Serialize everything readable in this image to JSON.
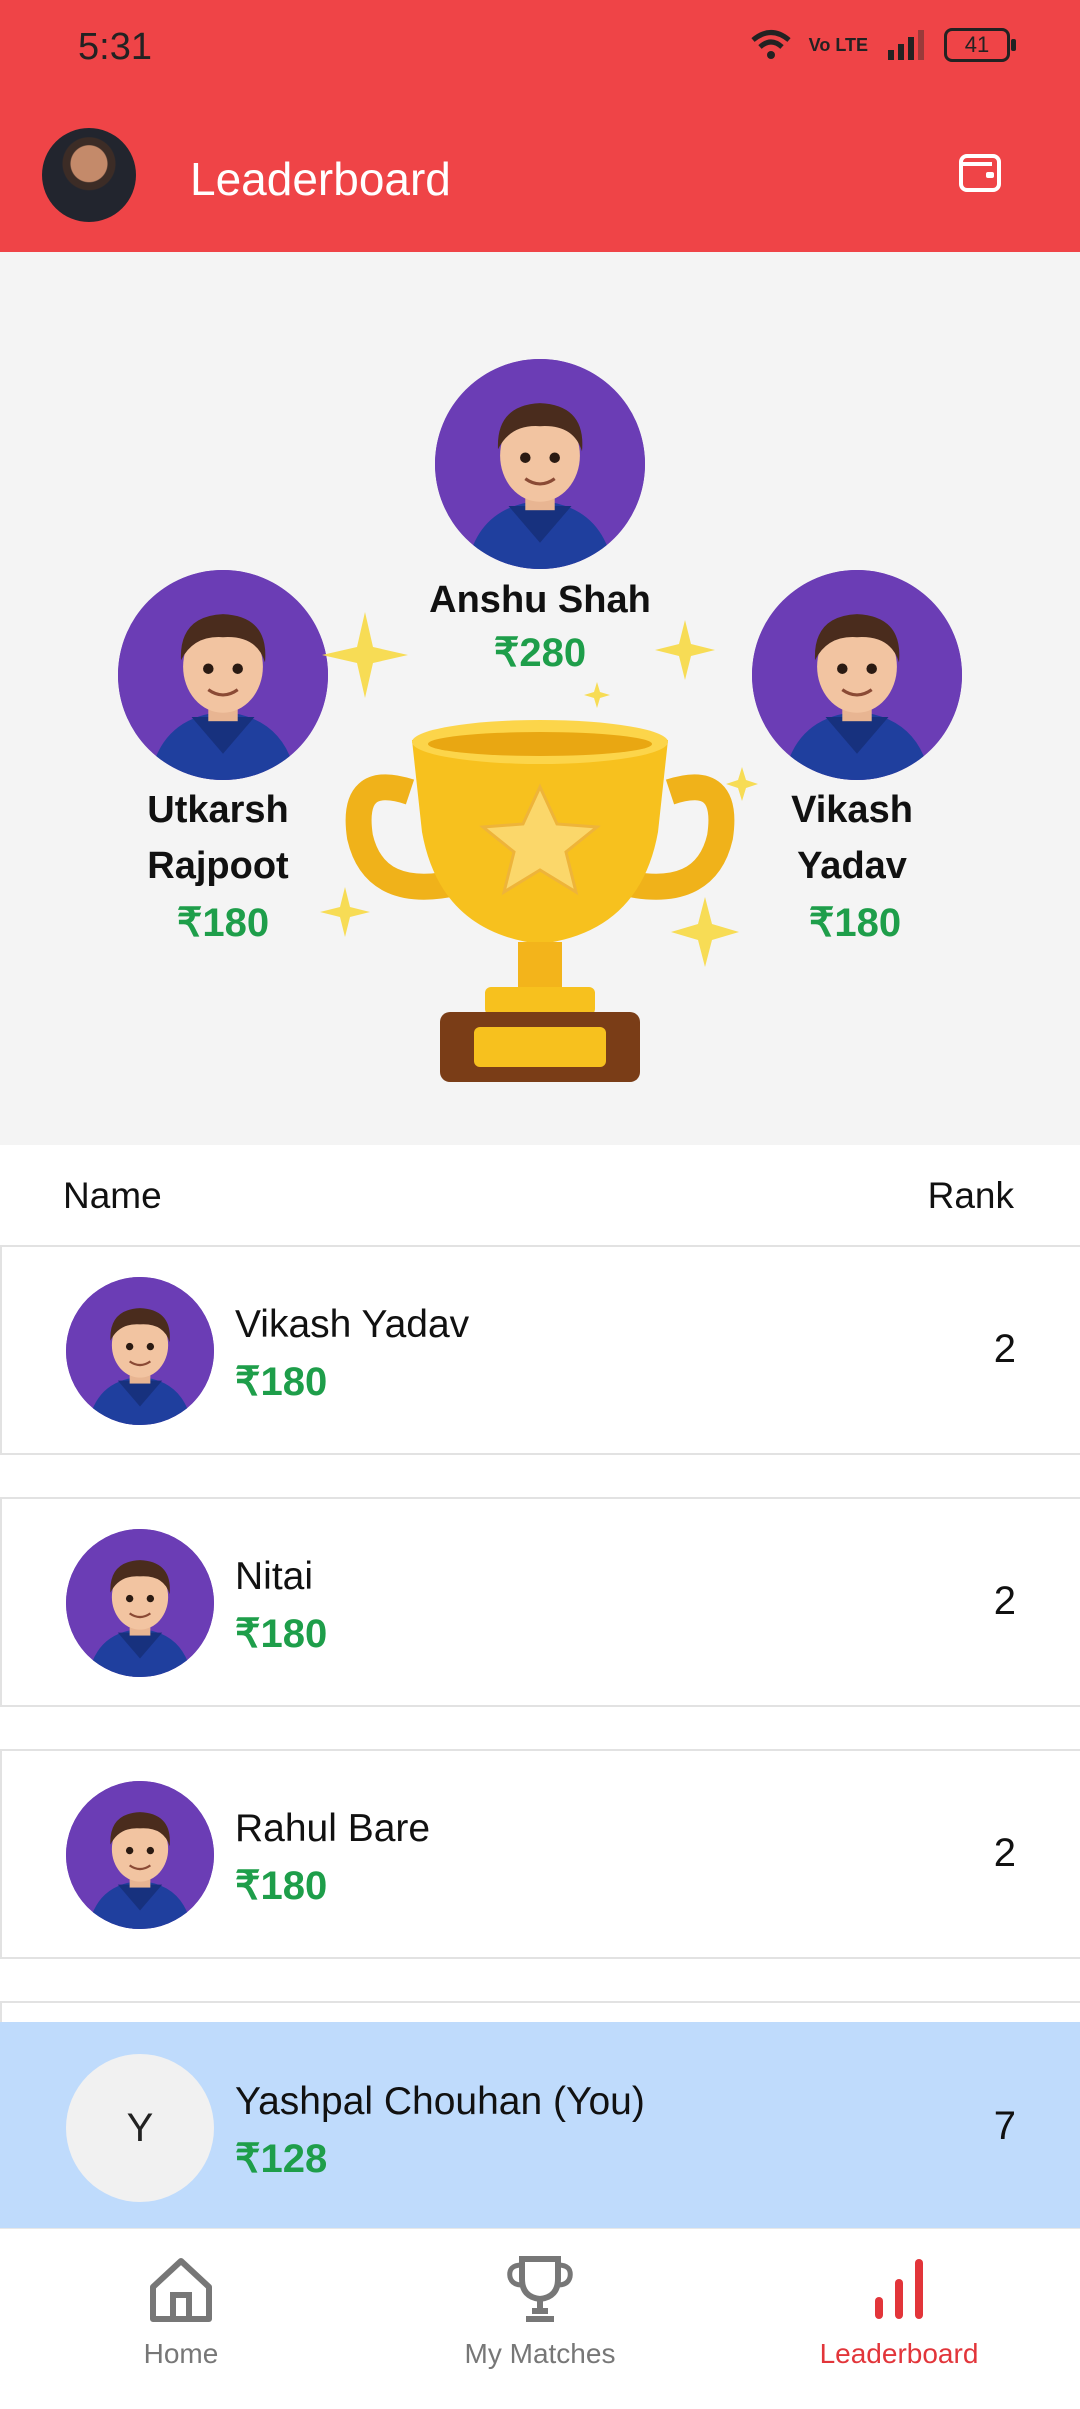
{
  "status_bar": {
    "time": "5:31",
    "network": "Vo LTE",
    "battery": "41"
  },
  "header": {
    "title": "Leaderboard"
  },
  "podium": {
    "first": {
      "name": "Anshu Shah",
      "amount": "₹280"
    },
    "second": {
      "name_line1": "Utkarsh",
      "name_line2": "Rajpoot",
      "amount": "₹180"
    },
    "third": {
      "name_line1": "Vikash",
      "name_line2": "Yadav",
      "amount": "₹180"
    }
  },
  "list": {
    "header_name": "Name",
    "header_rank": "Rank",
    "rows": [
      {
        "name": "Vikash Yadav",
        "amount": "₹180",
        "rank": "2"
      },
      {
        "name": "Nitai",
        "amount": "₹180",
        "rank": "2"
      },
      {
        "name": "Rahul Bare",
        "amount": "₹180",
        "rank": "2"
      }
    ],
    "you": {
      "initial": "Y",
      "name": "Yashpal Chouhan (You)",
      "amount": "₹128",
      "rank": "7"
    }
  },
  "nav": {
    "home": "Home",
    "matches": "My Matches",
    "leaderboard": "Leaderboard",
    "active": "leaderboard"
  },
  "colors": {
    "header": "#ef4447",
    "amount": "#1e9e4a",
    "you_row": "#bfdbfc",
    "avatar_bg": "#6b3db5"
  }
}
